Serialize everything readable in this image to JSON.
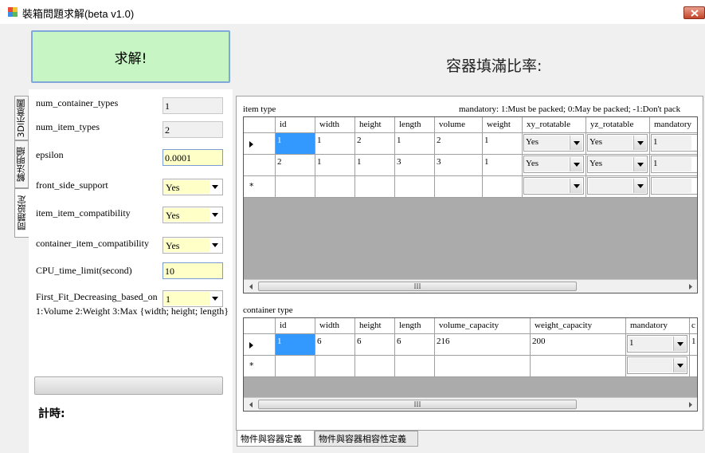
{
  "window": {
    "title": "裝箱問題求解(beta v1.0)"
  },
  "solve_label": "求解!",
  "fill_ratio_label": "容器填滿比率:",
  "vertical_tabs": [
    "問題設定",
    "解法明細",
    "3D示意圖"
  ],
  "params": {
    "num_container_types": {
      "label": "num_container_types",
      "value": "1"
    },
    "num_item_types": {
      "label": "num_item_types",
      "value": "2"
    },
    "epsilon": {
      "label": "epsilon",
      "value": "0.0001"
    },
    "front_side_support": {
      "label": "front_side_support",
      "value": "Yes"
    },
    "item_item_compatibility": {
      "label": "item_item_compatibility",
      "value": "Yes"
    },
    "container_item_compatibility": {
      "label": "container_item_compatibility",
      "value": "Yes"
    },
    "cpu_time_limit": {
      "label": "CPU_time_limit(second)",
      "value": "10"
    },
    "ffd": {
      "label": "First_Fit_Decreasing_based_on",
      "value": "1",
      "hint": "1:Volume  2:Weight 3:Max {width; height; length}"
    }
  },
  "timer_label": "計時:",
  "item_type": {
    "title": "item type",
    "note": "mandatory: 1:Must be packed; 0:May be packed; -1:Don't pack",
    "columns": [
      "id",
      "width",
      "height",
      "length",
      "volume",
      "weight",
      "xy_rotatable",
      "yz_rotatable",
      "mandatory"
    ],
    "rows": [
      [
        "1",
        "1",
        "2",
        "1",
        "2",
        "1",
        "Yes",
        "Yes",
        "1"
      ],
      [
        "2",
        "1",
        "1",
        "3",
        "3",
        "1",
        "Yes",
        "Yes",
        "1"
      ]
    ]
  },
  "container_type": {
    "title": "container type",
    "columns": [
      "id",
      "width",
      "height",
      "length",
      "volume_capacity",
      "weight_capacity",
      "mandatory",
      "c"
    ],
    "rows": [
      [
        "1",
        "6",
        "6",
        "6",
        "216",
        "200",
        "1",
        "1"
      ]
    ]
  },
  "scroll_grip": "III",
  "new_row_marker": "*",
  "bottom_tabs": [
    "物件與容器定義",
    "物件與容器相容性定義"
  ]
}
